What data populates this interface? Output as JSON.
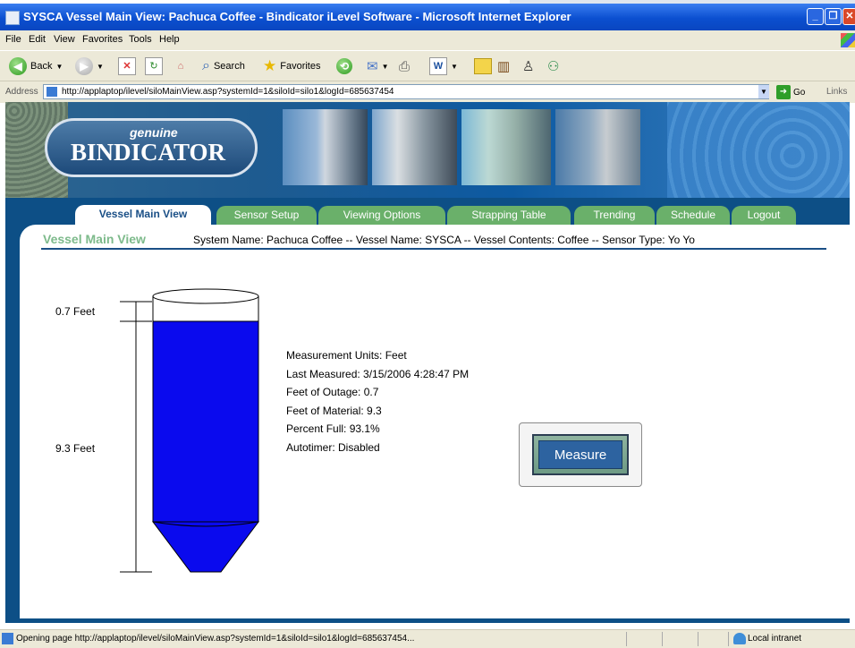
{
  "window": {
    "title": "SYSCA Vessel Main View: Pachuca Coffee - Bindicator iLevel Software - Microsoft Internet Explorer",
    "controls": [
      "_",
      "❐",
      "✕"
    ]
  },
  "menu": [
    "File",
    "Edit",
    "View",
    "Favorites",
    "Tools",
    "Help"
  ],
  "toolbar": {
    "back": "Back",
    "search": "Search",
    "favorites": "Favorites"
  },
  "address": {
    "label": "Address",
    "url": "http://applaptop/ilevel/siloMainView.asp?systemId=1&siloId=silo1&logId=685637454",
    "go": "Go",
    "links": "Links"
  },
  "brand": {
    "genuine": "genuine",
    "name": "BINDICATOR"
  },
  "tabs": [
    {
      "label": "Vessel Main View",
      "active": true
    },
    {
      "label": "Sensor Setup"
    },
    {
      "label": "Viewing Options"
    },
    {
      "label": "Strapping Table"
    },
    {
      "label": "Trending"
    },
    {
      "label": "Schedule"
    },
    {
      "label": "Logout"
    }
  ],
  "page": {
    "heading": "Vessel Main View",
    "system_line": "System Name: Pachuca Coffee -- Vessel Name: SYSCA -- Vessel Contents: Coffee -- Sensor Type: Yo Yo"
  },
  "vessel": {
    "outage_label": "0.7 Feet",
    "material_label": "9.3 Feet",
    "outage_ft": 0.7,
    "material_ft": 9.3,
    "material_color": "#0a0aee"
  },
  "info": {
    "units": "Measurement Units: Feet",
    "last_measured": "Last Measured: 3/15/2006 4:28:47 PM",
    "outage": "Feet of Outage: 0.7",
    "material": "Feet of Material: 9.3",
    "percent": "Percent Full: 93.1%",
    "autotimer": "Autotimer: Disabled"
  },
  "measure_button": "Measure",
  "status": {
    "text": "Opening page http://applaptop/ilevel/siloMainView.asp?systemId=1&siloId=silo1&logId=685637454...",
    "zone": "Local intranet"
  }
}
